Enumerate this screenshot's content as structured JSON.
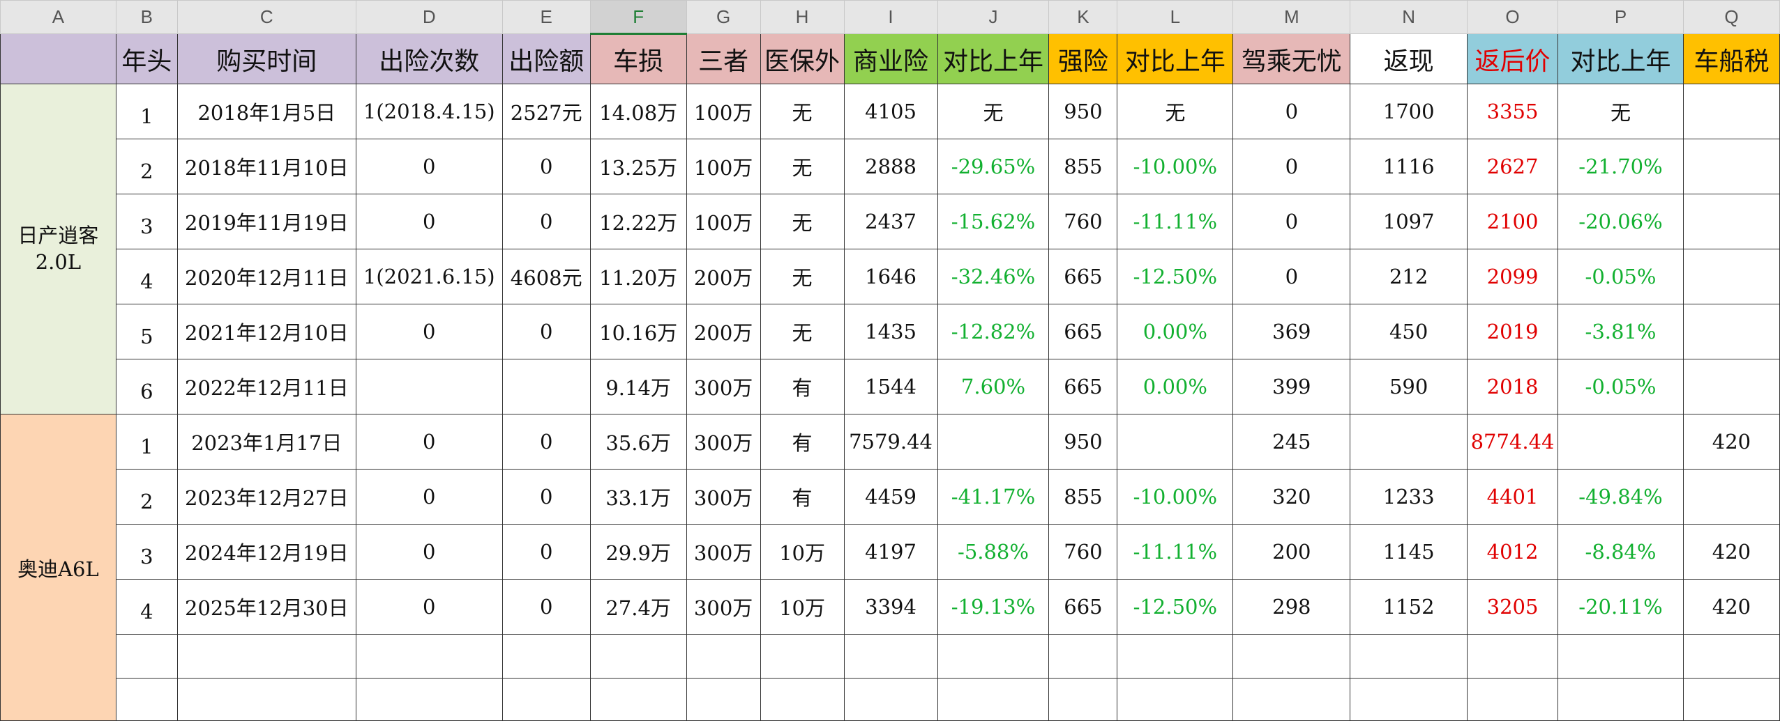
{
  "column_letters": [
    "A",
    "B",
    "C",
    "D",
    "E",
    "F",
    "G",
    "H",
    "I",
    "J",
    "K",
    "L",
    "M",
    "N",
    "O",
    "P",
    "Q"
  ],
  "active_column": "F",
  "header_colors": {
    "purple": "#ccc0da",
    "pink": "#e6b8b7",
    "green": "#92d050",
    "yellow": "#ffc000",
    "blue": "#92cddc",
    "white": "#ffffff",
    "red_text": "#e00000",
    "green_text": "#12b030"
  },
  "headers": [
    {
      "col": "A",
      "label": ""
    },
    {
      "col": "B",
      "label": "年头"
    },
    {
      "col": "C",
      "label": "购买时间"
    },
    {
      "col": "D",
      "label": "出险次数"
    },
    {
      "col": "E",
      "label": "出险额"
    },
    {
      "col": "F",
      "label": "车损"
    },
    {
      "col": "G",
      "label": "三者"
    },
    {
      "col": "H",
      "label": "医保外"
    },
    {
      "col": "I",
      "label": "商业险"
    },
    {
      "col": "J",
      "label": "对比上年"
    },
    {
      "col": "K",
      "label": "强险"
    },
    {
      "col": "L",
      "label": "对比上年"
    },
    {
      "col": "M",
      "label": "驾乘无忧"
    },
    {
      "col": "N",
      "label": "返现"
    },
    {
      "col": "O",
      "label": "返后价"
    },
    {
      "col": "P",
      "label": "对比上年"
    },
    {
      "col": "Q",
      "label": "车船税"
    }
  ],
  "groups": [
    {
      "label": "日产逍客 2.0L"
    },
    {
      "label": "奥迪A6L"
    }
  ],
  "rows": [
    {
      "cells": [
        "1",
        "2018年1月5日",
        "1(2018.4.15)",
        "2527元",
        "14.08万",
        "100万",
        "无",
        "4105",
        "无",
        "950",
        "无",
        "0",
        "1700",
        "3355",
        "无",
        ""
      ]
    },
    {
      "cells": [
        "2",
        "2018年11月10日",
        "0",
        "0",
        "13.25万",
        "100万",
        "无",
        "2888",
        "-29.65%",
        "855",
        "-10.00%",
        "0",
        "1116",
        "2627",
        "-21.70%",
        ""
      ]
    },
    {
      "cells": [
        "3",
        "2019年11月19日",
        "0",
        "0",
        "12.22万",
        "100万",
        "无",
        "2437",
        "-15.62%",
        "760",
        "-11.11%",
        "0",
        "1097",
        "2100",
        "-20.06%",
        ""
      ]
    },
    {
      "cells": [
        "4",
        "2020年12月11日",
        "1(2021.6.15)",
        "4608元",
        "11.20万",
        "200万",
        "无",
        "1646",
        "-32.46%",
        "665",
        "-12.50%",
        "0",
        "212",
        "2099",
        "-0.05%",
        ""
      ]
    },
    {
      "cells": [
        "5",
        "2021年12月10日",
        "0",
        "0",
        "10.16万",
        "200万",
        "无",
        "1435",
        "-12.82%",
        "665",
        "0.00%",
        "369",
        "450",
        "2019",
        "-3.81%",
        ""
      ]
    },
    {
      "cells": [
        "6",
        "2022年12月11日",
        "",
        "",
        "9.14万",
        "300万",
        "有",
        "1544",
        "7.60%",
        "665",
        "0.00%",
        "399",
        "590",
        "2018",
        "-0.05%",
        ""
      ]
    },
    {
      "cells": [
        "1",
        "2023年1月17日",
        "0",
        "0",
        "35.6万",
        "300万",
        "有",
        "7579.44",
        "",
        "950",
        "",
        "245",
        "",
        "8774.44",
        "",
        "420"
      ]
    },
    {
      "cells": [
        "2",
        "2023年12月27日",
        "0",
        "0",
        "33.1万",
        "300万",
        "有",
        "4459",
        "-41.17%",
        "855",
        "-10.00%",
        "320",
        "1233",
        "4401",
        "-49.84%",
        ""
      ]
    },
    {
      "cells": [
        "3",
        "2024年12月19日",
        "0",
        "0",
        "29.9万",
        "300万",
        "10万",
        "4197",
        "-5.88%",
        "760",
        "-11.11%",
        "200",
        "1145",
        "4012",
        "-8.84%",
        "420"
      ]
    },
    {
      "cells": [
        "4",
        "2025年12月30日",
        "0",
        "0",
        "27.4万",
        "300万",
        "10万",
        "3394",
        "-19.13%",
        "665",
        "-12.50%",
        "298",
        "1152",
        "3205",
        "-20.11%",
        "420"
      ]
    }
  ]
}
